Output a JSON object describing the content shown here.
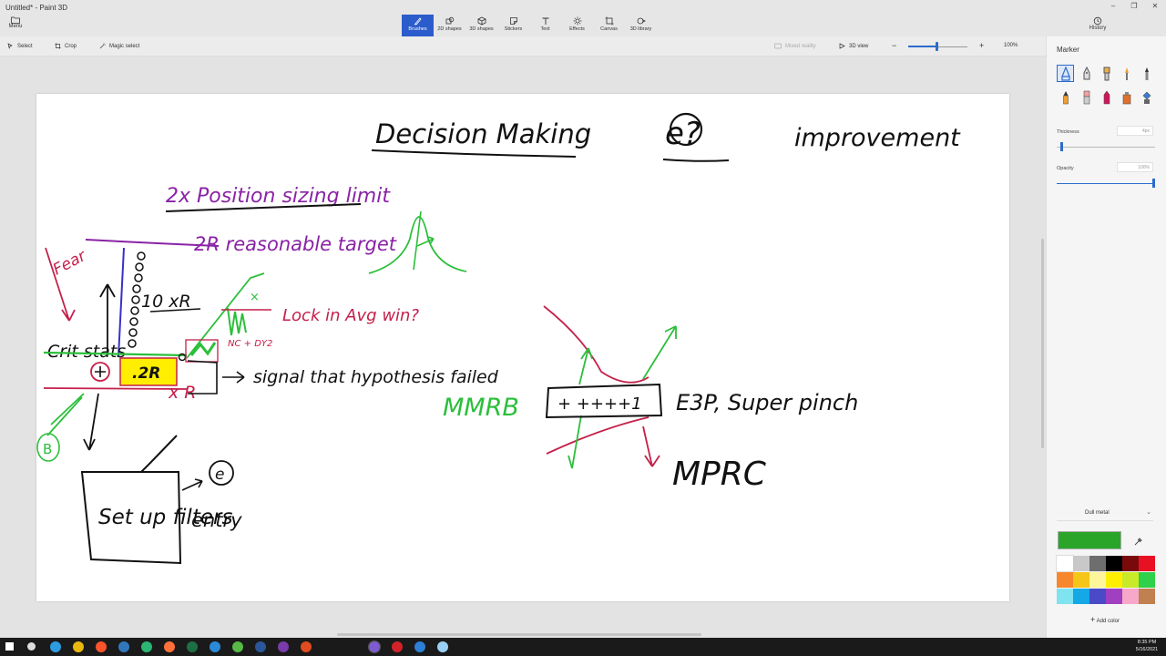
{
  "window": {
    "title": "Untitled* - Paint 3D",
    "minimize": "–",
    "restore": "❐",
    "close": "✕"
  },
  "menu": {
    "label": "Menu"
  },
  "ribbon": {
    "tabs": [
      {
        "label": "Brushes",
        "icon": "brush-icon",
        "active": true
      },
      {
        "label": "2D shapes",
        "icon": "2d-shapes-icon"
      },
      {
        "label": "3D shapes",
        "icon": "3d-shapes-icon"
      },
      {
        "label": "Stickers",
        "icon": "stickers-icon"
      },
      {
        "label": "Text",
        "icon": "text-icon"
      },
      {
        "label": "Effects",
        "icon": "effects-icon"
      },
      {
        "label": "Canvas",
        "icon": "canvas-icon"
      },
      {
        "label": "3D library",
        "icon": "3d-library-icon"
      }
    ]
  },
  "history": {
    "label": "History"
  },
  "toolbar": {
    "select": "Select",
    "crop": "Crop",
    "magic_select": "Magic select",
    "mixed_reality": "Mixed reality",
    "view_3d": "3D view",
    "zoom_minus": "−",
    "zoom_plus": "+",
    "zoom_value": "100%",
    "zoom_level": 0.48
  },
  "panel": {
    "title": "Marker",
    "thickness_label": "Thickness",
    "thickness_value": "4px",
    "thickness_level": 0.04,
    "opacity_label": "Opacity",
    "opacity_value": "100%",
    "opacity_level": 1.0,
    "finish": "Dull metal",
    "current_color": "#2aa52a",
    "add_color": "Add color",
    "brushes": [
      "marker",
      "calligraphy-pen",
      "oil-brush",
      "watercolor",
      "pixel-pen",
      "pencil",
      "eraser",
      "crayon",
      "spray-can",
      "fill"
    ],
    "palette": [
      "#ffffff",
      "#c8c8c8",
      "#6e6e6e",
      "#000000",
      "#7a0a0a",
      "#e81123",
      "#f7872c",
      "#f5c518",
      "#fff59a",
      "#ffee00",
      "#c8ea28",
      "#2fd04a",
      "#7fe3f0",
      "#14a8e6",
      "#4a4ac8",
      "#a040c0",
      "#f7a8c8",
      "#c08050"
    ]
  },
  "canvas": {
    "notes": {
      "title": "Decision Making",
      "e_question": "e?",
      "improvement": "improvement",
      "position_sizing": "2x Position sizing limit",
      "two_r": "2R reasonable target",
      "fear": "Fear",
      "ten_xr": "10 xR",
      "lock_in": "Lock in Avg win?",
      "crit_stats": "Crit stats",
      "point_two_r": ".2R",
      "x_r": "x R",
      "signal": "signal that hypothesis failed",
      "b": "B",
      "e": "e",
      "setup": "Set up filters",
      "entry": "entry",
      "mmrb": "MMRB",
      "ticks": "+ ++++1",
      "e3p": "E3P, Super pinch",
      "mprc": "MPRC",
      "nc_dy2": "NC + DY2"
    }
  },
  "taskbar": {
    "time": "8:35 PM",
    "date": "5/16/2021",
    "apps": [
      {
        "name": "start-icon",
        "color": "#ffffff"
      },
      {
        "name": "search-icon",
        "color": "#dddddd"
      },
      {
        "name": "edge-icon",
        "color": "#2d9be0"
      },
      {
        "name": "chrome-icon",
        "color": "#e8b80e"
      },
      {
        "name": "brave-icon",
        "color": "#fb542b"
      },
      {
        "name": "edge-legacy-icon",
        "color": "#3277bc"
      },
      {
        "name": "tradingview-icon",
        "color": "#2bb673"
      },
      {
        "name": "firefox-icon",
        "color": "#ff7139"
      },
      {
        "name": "excel-icon",
        "color": "#1d7044"
      },
      {
        "name": "app-blue-icon",
        "color": "#2a8ad8"
      },
      {
        "name": "camtasia-icon",
        "color": "#58b947"
      },
      {
        "name": "word-icon",
        "color": "#2b579a"
      },
      {
        "name": "onenote-icon",
        "color": "#7a3baa"
      },
      {
        "name": "recorder-icon",
        "color": "#e04c1f"
      },
      {
        "name": "paint3d-icon",
        "color": "#7e5bd1"
      },
      {
        "name": "app-red-icon",
        "color": "#d2232a"
      },
      {
        "name": "snip-icon",
        "color": "#2e7fd6"
      },
      {
        "name": "app-light-icon",
        "color": "#9ad0f5"
      }
    ]
  }
}
